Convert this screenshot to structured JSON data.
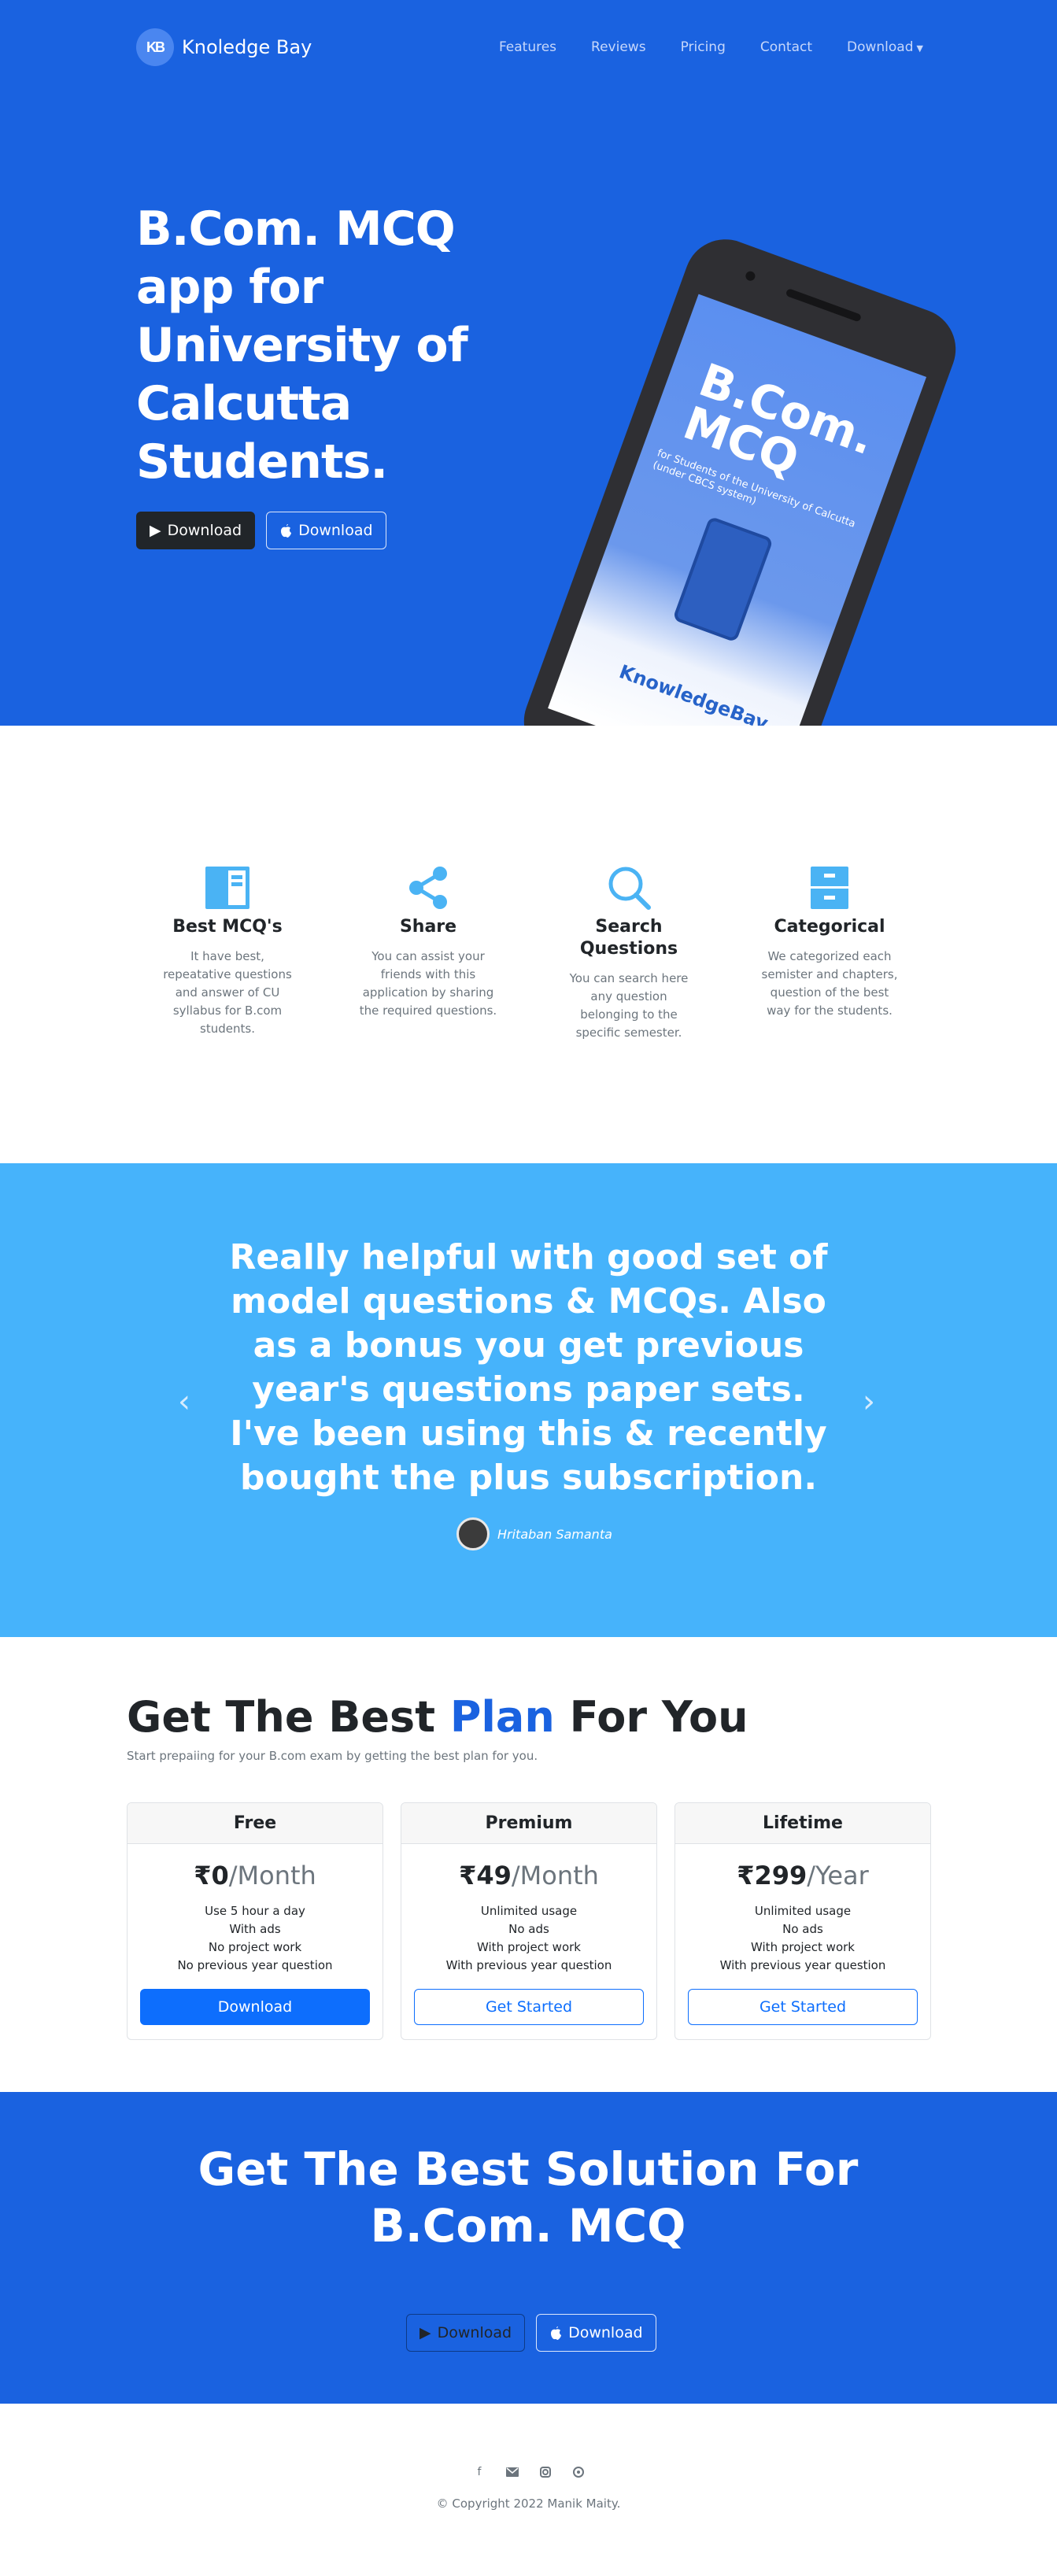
{
  "nav": {
    "brand_logo_text": "KB",
    "brand_name": "Knoledge Bay",
    "links": [
      "Features",
      "Reviews",
      "Pricing",
      "Contact",
      "Download"
    ]
  },
  "hero": {
    "title": "B.Com. MCQ app for University of Calcutta Students.",
    "buttons": [
      {
        "label": "Download",
        "icon": "play-store-icon"
      },
      {
        "label": "Download",
        "icon": "apple-icon"
      }
    ],
    "phone_screen": {
      "title": "B.Com. MCQ",
      "subtitle": "for Students of the University of Calcutta (under CBCS system)",
      "logo_text": "KnowledgeBay"
    }
  },
  "features": [
    {
      "icon": "book-icon",
      "title": "Best MCQ's",
      "text": "It have best, repeatative questions and answer of CU syllabus for B.com students."
    },
    {
      "icon": "share-icon",
      "title": "Share",
      "text": "You can assist your friends with this application by sharing the required questions."
    },
    {
      "icon": "search-icon",
      "title": "Search Questions",
      "text": "You can search here any question belonging to the specific semester."
    },
    {
      "icon": "archive-icon",
      "title": "Categorical",
      "text": "We categorized each semister and chapters, question of the best way for the students."
    }
  ],
  "testimonial": {
    "quote": "Really helpful with good set of model questions & MCQs. Also as a bonus you get previous year's questions paper sets. I've been using this & recently bought the plus subscription.",
    "author": "Hritaban Samanta",
    "prev_icon": "chevron-left-icon",
    "next_icon": "chevron-right-icon"
  },
  "pricing": {
    "title_pre": "Get The Best ",
    "title_accent": "Plan",
    "title_post": " For You",
    "subtitle": "Start prepaiing for your B.com exam by getting the best plan for you.",
    "plans": [
      {
        "name": "Free",
        "amount": "₹0",
        "period": "/Month",
        "features": [
          "Use 5 hour a day",
          "With ads",
          "No project work",
          "No previous year question"
        ],
        "button": "Download"
      },
      {
        "name": "Premium",
        "amount": "₹49",
        "period": "/Month",
        "features": [
          "Unlimited usage",
          "No ads",
          "With project work",
          "With previous year question"
        ],
        "button": "Get Started"
      },
      {
        "name": "Lifetime",
        "amount": "₹299",
        "period": "/Year",
        "features": [
          "Unlimited usage",
          "No ads",
          "With project work",
          "With previous year question"
        ],
        "button": "Get Started"
      }
    ]
  },
  "cta": {
    "title": "Get The Best Solution For B.Com. MCQ",
    "buttons": [
      {
        "label": "Download",
        "icon": "play-store-icon"
      },
      {
        "label": "Download",
        "icon": "apple-icon"
      }
    ]
  },
  "footer": {
    "socials": [
      "facebook-icon",
      "mail-icon",
      "instagram-icon",
      "whatsapp-icon"
    ],
    "copyright": "© Copyright 2022 Manik Maity."
  },
  "colors": {
    "primary_blue": "#1a62e0",
    "light_blue": "#46b3fb",
    "icon_blue": "#4ab3f4",
    "button_blue": "#0d6efd",
    "dark": "#212529",
    "muted": "#6c757d"
  }
}
